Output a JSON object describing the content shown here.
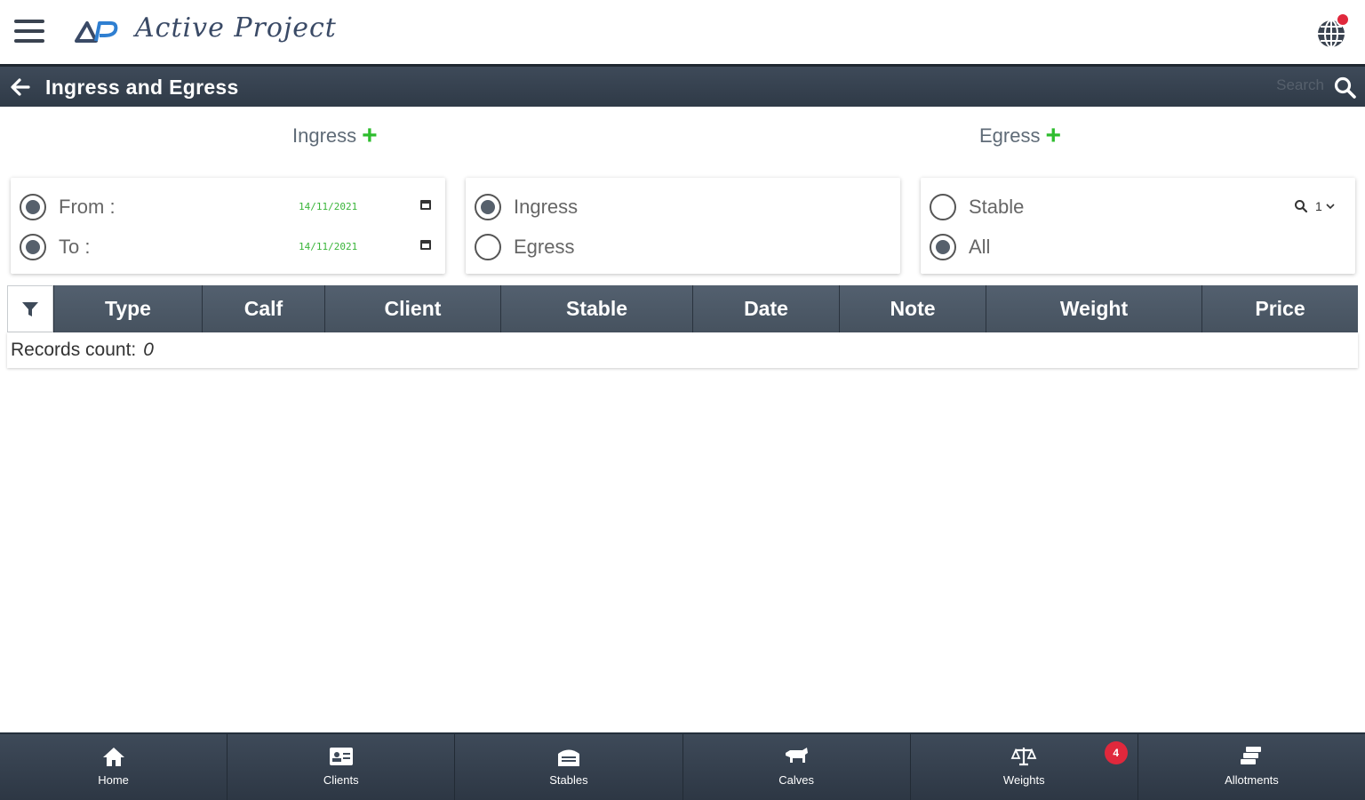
{
  "app": {
    "title": "Active Project"
  },
  "header": {
    "title": "Ingress and Egress",
    "search_placeholder": "Search"
  },
  "actions": {
    "ingress_label": "Ingress",
    "egress_label": "Egress",
    "plus": "+"
  },
  "filters": {
    "date": {
      "from_label": "From :",
      "to_label": "To :",
      "from_value": "14/11/2021",
      "to_value": "14/11/2021"
    },
    "type": {
      "ingress_label": "Ingress",
      "egress_label": "Egress",
      "selected": "Ingress"
    },
    "stable": {
      "stable_label": "Stable",
      "all_label": "All",
      "selected": "All",
      "picker_value": "1"
    }
  },
  "table": {
    "columns": [
      "Type",
      "Calf",
      "Client",
      "Stable",
      "Date",
      "Note",
      "Weight",
      "Price"
    ],
    "records_label": "Records count:",
    "records_count": "0"
  },
  "bottom_nav": {
    "items": [
      {
        "label": "Home",
        "icon": "home-icon"
      },
      {
        "label": "Clients",
        "icon": "id-card-icon"
      },
      {
        "label": "Stables",
        "icon": "stable-icon"
      },
      {
        "label": "Calves",
        "icon": "calf-icon"
      },
      {
        "label": "Weights",
        "icon": "scale-icon",
        "badge": "4"
      },
      {
        "label": "Allotments",
        "icon": "allotments-icon"
      }
    ]
  },
  "colors": {
    "bar": "#3e4a59",
    "accent_green": "#2ebd2e",
    "badge_red": "#e0283c",
    "date_green": "#3ab53a"
  }
}
